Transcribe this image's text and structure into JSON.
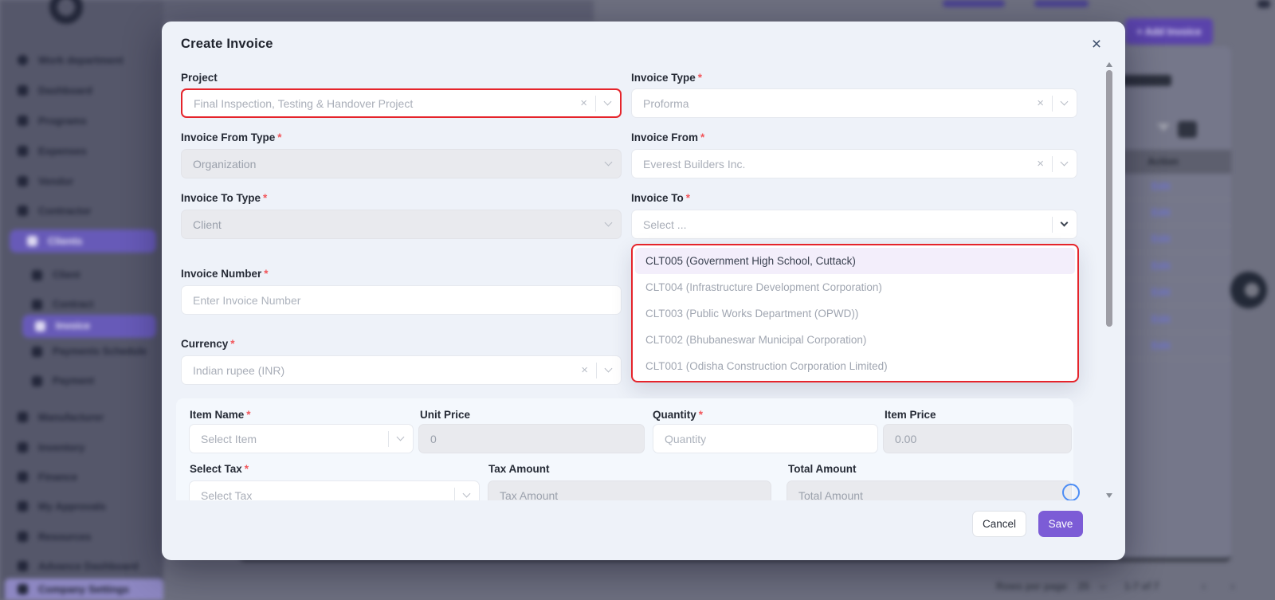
{
  "colors": {
    "accent_purple": "#7c5cd6",
    "annotation_red": "#e5242b",
    "active_option_bg": "#f3eefb",
    "sidebar_active": "#675ab8"
  },
  "icons": {
    "close": "×",
    "clear": "×",
    "add": "+",
    "prev": "‹",
    "next": "›"
  },
  "modal": {
    "title": "Create Invoice",
    "asterisk": "*",
    "fields": {
      "project": {
        "label": "Project",
        "value": "Final Inspection, Testing & Handover Project"
      },
      "invoice_type": {
        "label": "Invoice Type",
        "value": "Proforma"
      },
      "invoice_from_type": {
        "label": "Invoice From Type",
        "value": "Organization"
      },
      "invoice_from": {
        "label": "Invoice From",
        "value": "Everest Builders Inc."
      },
      "invoice_to_type": {
        "label": "Invoice To Type",
        "value": "Client"
      },
      "invoice_to": {
        "label": "Invoice To",
        "placeholder": "Select ..."
      },
      "invoice_number": {
        "label": "Invoice Number",
        "placeholder": "Enter Invoice Number"
      },
      "currency": {
        "label": "Currency",
        "value": "Indian rupee (INR)"
      }
    },
    "invoice_to_options": [
      {
        "label": "CLT005 (Government High School, Cuttack)"
      },
      {
        "label": "CLT004 (Infrastructure Development Corporation)"
      },
      {
        "label": "CLT003 (Public Works Department (OPWD))"
      },
      {
        "label": "CLT002 (Bhubaneswar Municipal Corporation)"
      },
      {
        "label": "CLT001 (Odisha Construction Corporation Limited)"
      }
    ],
    "item_section": {
      "item_name_label": "Item Name",
      "item_name_placeholder": "Select Item",
      "unit_price_label": "Unit Price",
      "unit_price_value": "0",
      "quantity_label": "Quantity",
      "quantity_placeholder": "Quantity",
      "item_price_label": "Item Price",
      "item_price_value": "0.00",
      "select_tax_label": "Select Tax",
      "select_tax_placeholder": "Select Tax",
      "tax_amount_label": "Tax Amount",
      "tax_amount_placeholder": "Tax Amount",
      "total_amount_label": "Total Amount",
      "total_amount_placeholder": "Total Amount"
    },
    "footer": {
      "cancel": "Cancel",
      "save": "Save"
    }
  },
  "sidebar": {
    "items": [
      {
        "label": "Work department"
      },
      {
        "label": "Dashboard"
      },
      {
        "label": "Programs"
      },
      {
        "label": "Expenses"
      },
      {
        "label": "Vendor"
      },
      {
        "label": "Contractor"
      },
      {
        "label": "Clients"
      },
      {
        "label": "Client"
      },
      {
        "label": "Contract"
      },
      {
        "label": "Invoice"
      },
      {
        "label": "Payments Schedule"
      },
      {
        "label": "Payment"
      },
      {
        "label": "Manufacturer"
      },
      {
        "label": "Inventory"
      },
      {
        "label": "Finance"
      },
      {
        "label": "My Approvals"
      },
      {
        "label": "Resources"
      },
      {
        "label": "Advance Dashboard"
      },
      {
        "label": "Company Settings"
      }
    ]
  },
  "background": {
    "add_invoice_button": "+ Add Invoice",
    "table": {
      "action_header": "Action",
      "edit_label": "Edit"
    },
    "pagination": {
      "rows_per_page_label": "Rows per page",
      "rows_per_page_value": "25",
      "range_label": "1-7 of 7",
      "prev": "‹",
      "next": "›"
    }
  }
}
